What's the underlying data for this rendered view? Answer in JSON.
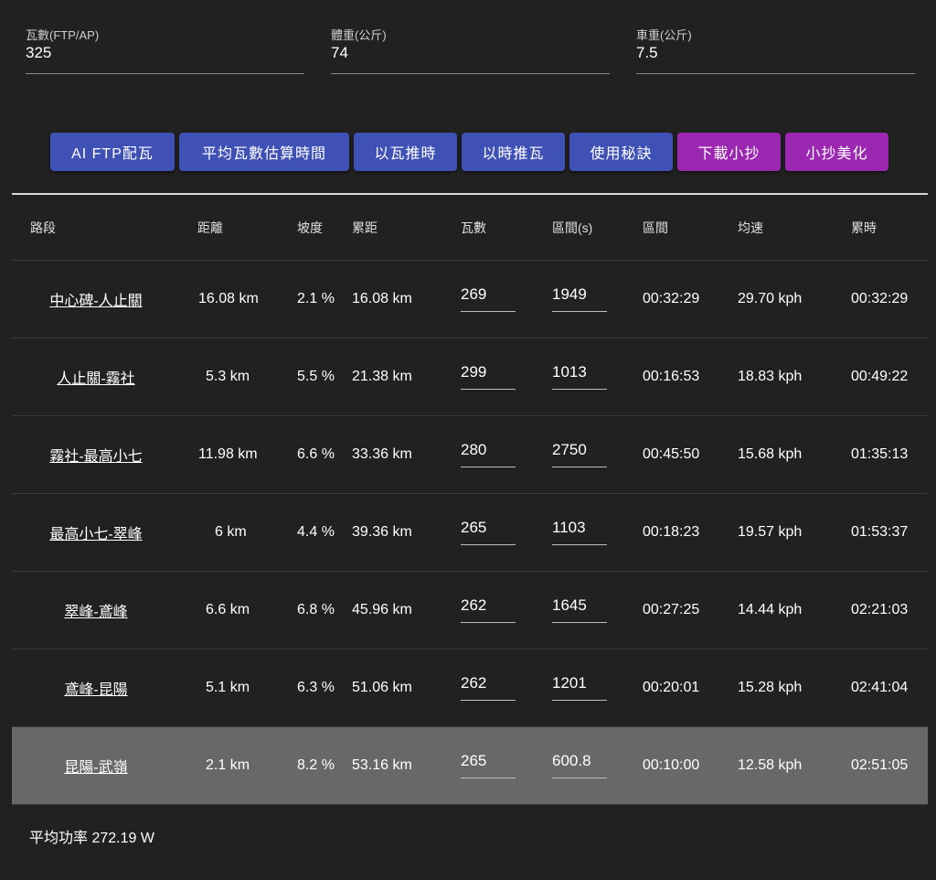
{
  "inputs": [
    {
      "label": "瓦數(FTP/AP)",
      "value": "325"
    },
    {
      "label": "體重(公斤)",
      "value": "74"
    },
    {
      "label": "車重(公斤)",
      "value": "7.5"
    }
  ],
  "buttons": [
    {
      "label": "AI FTP配瓦",
      "color": "#3f51b5"
    },
    {
      "label": "平均瓦數估算時間",
      "color": "#3f51b5"
    },
    {
      "label": "以瓦推時",
      "color": "#3f51b5"
    },
    {
      "label": "以時推瓦",
      "color": "#3f51b5"
    },
    {
      "label": "使用秘訣",
      "color": "#3f51b5"
    },
    {
      "label": "下載小抄",
      "color": "#9c27b0"
    },
    {
      "label": "小抄美化",
      "color": "#9c27b0"
    }
  ],
  "table": {
    "headers": [
      "路段",
      "距離",
      "坡度",
      "累距",
      "瓦數",
      "區間(s)",
      "區間",
      "均速",
      "累時"
    ],
    "rows": [
      {
        "segment": "中心碑-人止關",
        "distance": "16.08 km",
        "grade": "2.1 %",
        "cum_distance": "16.08 km",
        "watts": "269",
        "interval_s": "1949",
        "interval": "00:32:29",
        "speed": "29.70 kph",
        "cum_time": "00:32:29"
      },
      {
        "segment": "人止關-霧社",
        "distance": "5.3 km",
        "grade": "5.5 %",
        "cum_distance": "21.38 km",
        "watts": "299",
        "interval_s": "1013",
        "interval": "00:16:53",
        "speed": "18.83 kph",
        "cum_time": "00:49:22"
      },
      {
        "segment": "霧社-最高小七",
        "distance": "11.98 km",
        "grade": "6.6 %",
        "cum_distance": "33.36 km",
        "watts": "280",
        "interval_s": "2750",
        "interval": "00:45:50",
        "speed": "15.68 kph",
        "cum_time": "01:35:13"
      },
      {
        "segment": "最高小七-翠峰",
        "distance": "6 km",
        "grade": "4.4 %",
        "cum_distance": "39.36 km",
        "watts": "265",
        "interval_s": "1103",
        "interval": "00:18:23",
        "speed": "19.57 kph",
        "cum_time": "01:53:37"
      },
      {
        "segment": "翠峰-鳶峰",
        "distance": "6.6 km",
        "grade": "6.8 %",
        "cum_distance": "45.96 km",
        "watts": "262",
        "interval_s": "1645",
        "interval": "00:27:25",
        "speed": "14.44 kph",
        "cum_time": "02:21:03"
      },
      {
        "segment": "鳶峰-昆陽",
        "distance": "5.1 km",
        "grade": "6.3 %",
        "cum_distance": "51.06 km",
        "watts": "262",
        "interval_s": "1201",
        "interval": "00:20:01",
        "speed": "15.28 kph",
        "cum_time": "02:41:04"
      },
      {
        "segment": "昆陽-武嶺",
        "distance": "2.1 km",
        "grade": "8.2 %",
        "cum_distance": "53.16 km",
        "watts": "265",
        "interval_s": "600.8",
        "interval": "00:10:00",
        "speed": "12.58 kph",
        "cum_time": "02:51:05"
      }
    ]
  },
  "footer": {
    "avg_power": "平均功率 272.19 W"
  }
}
